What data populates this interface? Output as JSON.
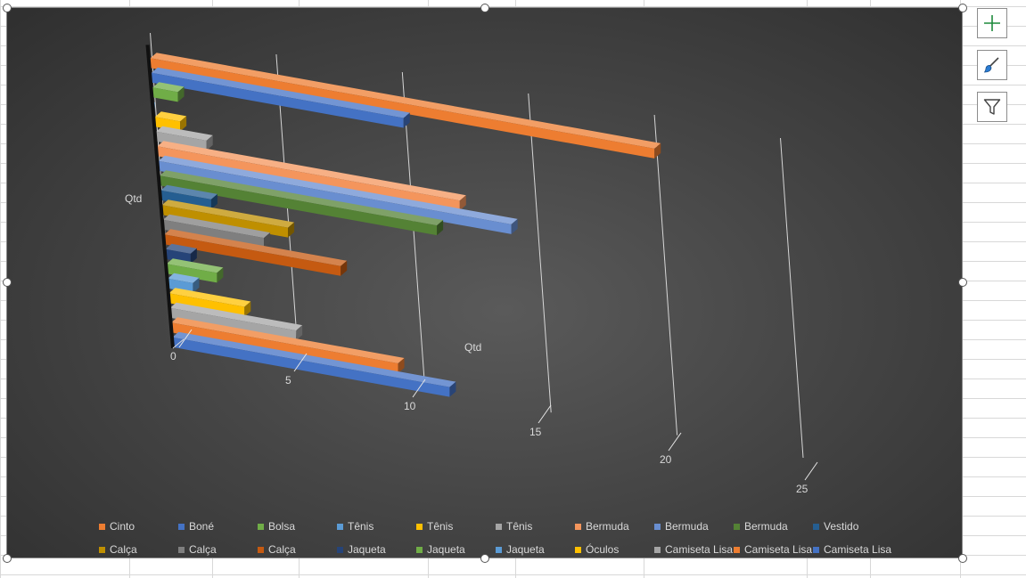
{
  "chart_data": {
    "type": "bar",
    "orientation": "horizontal",
    "three_d": true,
    "title": "",
    "depth_axis_label": "Qtd",
    "value_axis_label": "Qtd",
    "xlim": [
      0,
      25
    ],
    "x_ticks": [
      "0",
      "5",
      "10",
      "15",
      "20",
      "25"
    ],
    "grid": true,
    "legend_position": "bottom",
    "series": [
      {
        "name": "Cinto",
        "value": 20,
        "color": "#ed7d31"
      },
      {
        "name": "Boné",
        "value": 10,
        "color": "#4472c4"
      },
      {
        "name": "Bolsa",
        "value": 1,
        "color": "#70ad47"
      },
      {
        "name": "Tênis",
        "value": 0,
        "color": "#5b9bd5"
      },
      {
        "name": "Tênis",
        "value": 1,
        "color": "#ffc000"
      },
      {
        "name": "Tênis",
        "value": 2,
        "color": "#a5a5a5"
      },
      {
        "name": "Bermuda",
        "value": 12,
        "color": "#f4955c"
      },
      {
        "name": "Bermuda",
        "value": 14,
        "color": "#698ed0"
      },
      {
        "name": "Bermuda",
        "value": 11,
        "color": "#548235"
      },
      {
        "name": "Vestido",
        "value": 2,
        "color": "#255e91"
      },
      {
        "name": "Calça",
        "value": 5,
        "color": "#bf8f00"
      },
      {
        "name": "Calça",
        "value": 4,
        "color": "#7f7f7f"
      },
      {
        "name": "Calça",
        "value": 7,
        "color": "#c55a11"
      },
      {
        "name": "Jaqueta",
        "value": 1,
        "color": "#264478"
      },
      {
        "name": "Jaqueta",
        "value": 2,
        "color": "#70ad47"
      },
      {
        "name": "Jaqueta",
        "value": 1,
        "color": "#5b9bd5"
      },
      {
        "name": "Óculos",
        "value": 3,
        "color": "#ffc000"
      },
      {
        "name": "Camiseta Lisa",
        "value": 5,
        "color": "#a5a5a5"
      },
      {
        "name": "Camiseta Lisa",
        "value": 9,
        "color": "#ed7d31"
      },
      {
        "name": "Camiseta Lisa",
        "value": 11,
        "color": "#4472c4"
      }
    ]
  },
  "toolbar": {
    "chart_elements_icon": "plus-icon",
    "chart_styles_icon": "paintbrush-icon",
    "chart_filters_icon": "funnel-icon"
  }
}
